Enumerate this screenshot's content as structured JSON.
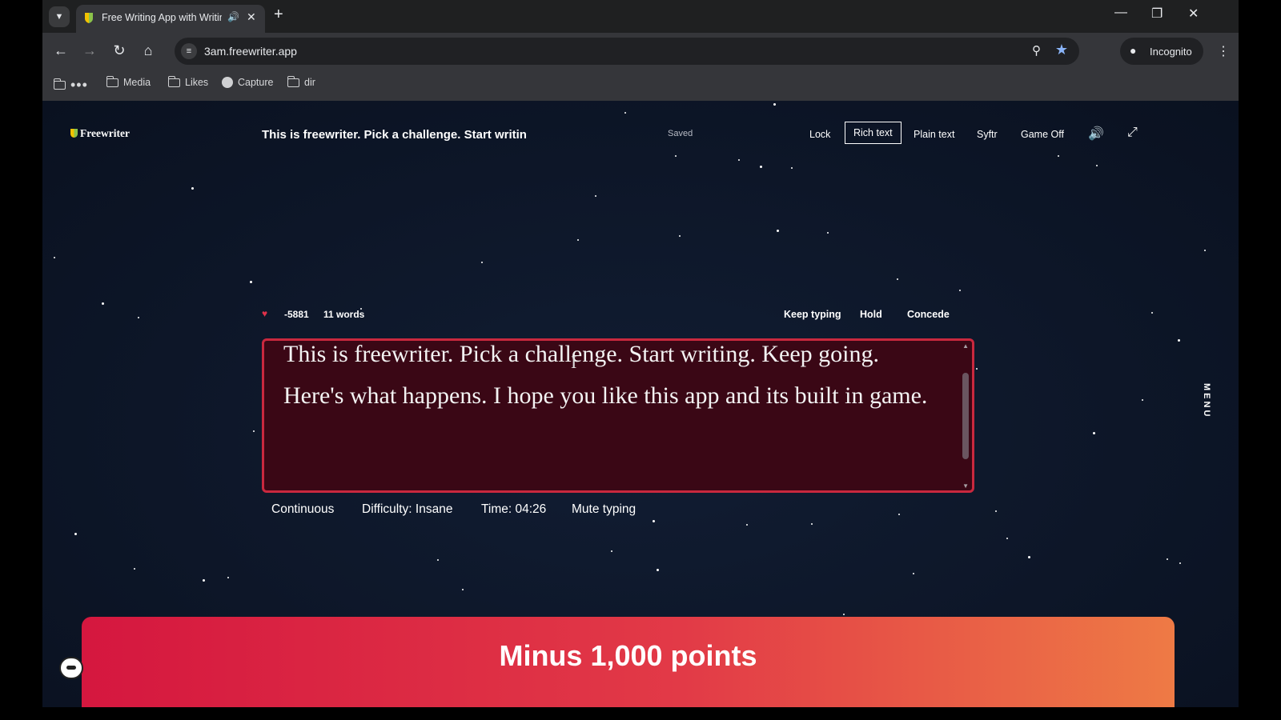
{
  "browser": {
    "tab_title": "Free Writing App with Writing Game",
    "url": "3am.freewriter.app",
    "incognito_label": "Incognito",
    "bookmarks": [
      "Media",
      "Likes",
      "Capture",
      "dir"
    ]
  },
  "app": {
    "logo": "Freewriter",
    "doc_title": "This is freewriter. Pick a challenge. Start writin",
    "save_status": "Saved",
    "top_nav": [
      "Lock",
      "Rich text",
      "Plain text",
      "Syftr",
      "Game Off"
    ],
    "active_mode": "Rich text",
    "side_menu": "MENU"
  },
  "game": {
    "score": "-5881",
    "word_count": "11 words",
    "actions": [
      "Keep typing",
      "Hold",
      "Concede"
    ],
    "editor_text": "This is freewriter. Pick a challenge. Start writing. Keep going. Here's what happens. I hope you like this app and its built in game.",
    "options": [
      "Continuous",
      "Difficulty: Insane",
      "Time: 04:26",
      "Mute typing"
    ],
    "banner": "Minus 1,000 points"
  },
  "colors": {
    "accent_red": "#c9283e",
    "banner_start": "#d5173f",
    "banner_end": "#ee7a45",
    "page_bg": "#0d1524"
  }
}
